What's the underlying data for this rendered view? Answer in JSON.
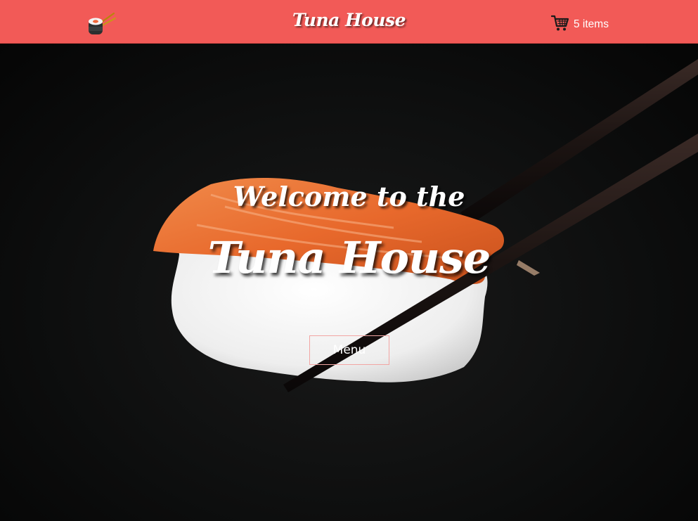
{
  "navbar": {
    "brand": "Tuna House",
    "logo_icon": "sushi-roll-chopsticks-icon",
    "cart": {
      "icon": "shopping-cart-icon",
      "label": "5 items"
    },
    "background_color": "#f25a57"
  },
  "hero": {
    "welcome": "Welcome to the",
    "title": "Tuna House",
    "menu_button": "Menu",
    "image": "salmon-nigiri-with-chopsticks"
  }
}
